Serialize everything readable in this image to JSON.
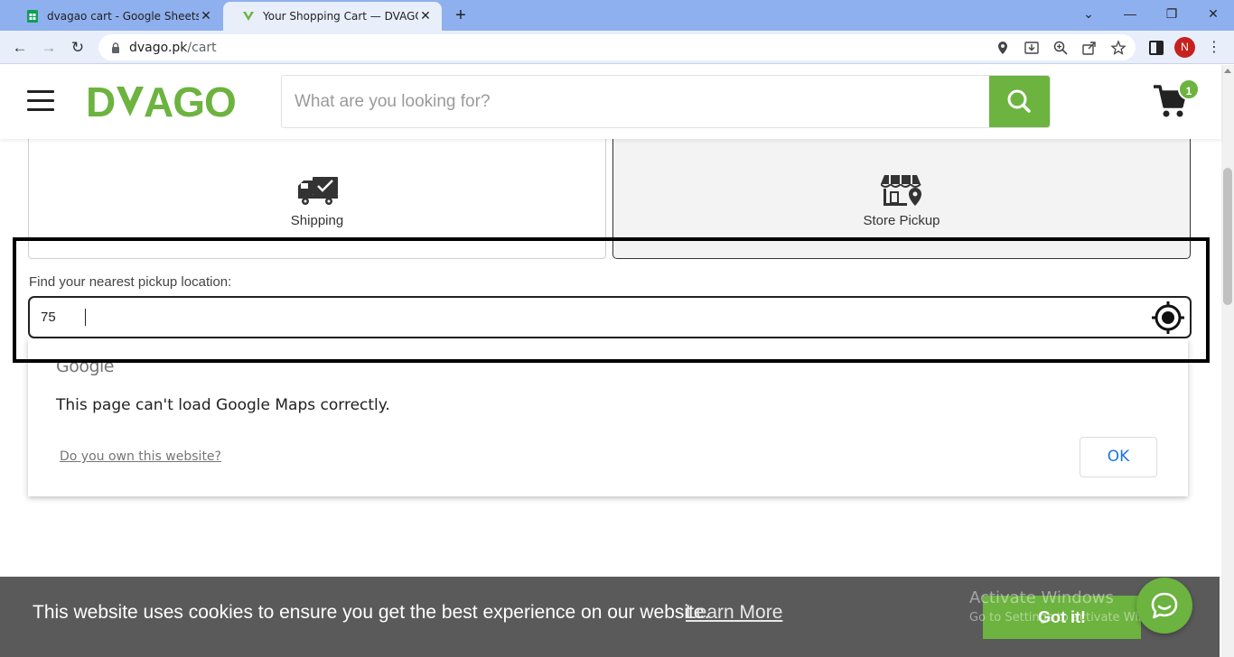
{
  "browser": {
    "tabs": [
      {
        "title": "dvagao cart - Google Sheets",
        "active": false
      },
      {
        "title": "Your Shopping Cart — DVAGO®",
        "active": true
      }
    ],
    "url_host": "dvago.pk",
    "url_path": "/cart",
    "profile_initial": "N",
    "accent_color": "#8fb0ee"
  },
  "header": {
    "logo_text": "DVAGO",
    "search_placeholder": "What are you looking for?",
    "cart_count": "1",
    "brand_color": "#6cb33f"
  },
  "delivery": {
    "options": [
      {
        "label": "Shipping",
        "icon": "truck-check-icon",
        "selected": false
      },
      {
        "label": "Store Pickup",
        "icon": "store-location-icon",
        "selected": true
      }
    ]
  },
  "pickup": {
    "label": "Find your nearest pickup location:",
    "value": "75"
  },
  "map_error": {
    "wordmark": "Google",
    "message": "This page can't load Google Maps correctly.",
    "link": "Do you own this website?",
    "ok": "OK"
  },
  "cookie": {
    "message": "This website uses cookies to ensure you get the best experience on our website.",
    "learn_more": "Learn More",
    "button": "Got it!"
  },
  "os_watermark": {
    "line1": "Activate Windows",
    "line2": "Go to Settings to activate Windows."
  }
}
